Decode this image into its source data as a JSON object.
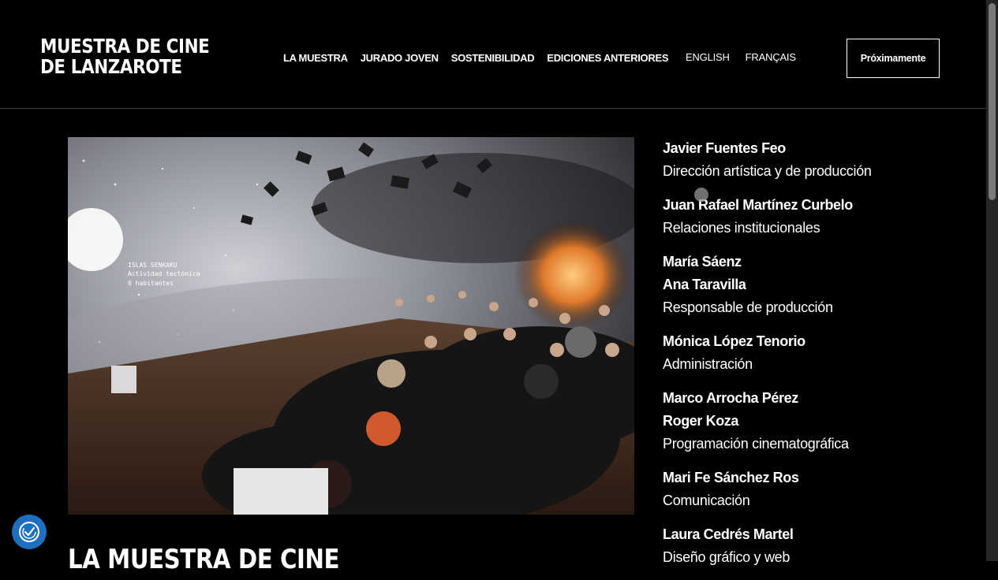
{
  "header": {
    "logo_line1": "MUESTRA DE CINE",
    "logo_line2": "DE LANZAROTE",
    "nav": [
      "LA MUESTRA",
      "JURADO JOVEN",
      "SOSTENIBILIDAD",
      "EDICIONES ANTERIORES"
    ],
    "languages": [
      "ENGLISH",
      "FRANÇAIS"
    ],
    "cta_label": "Próximamente"
  },
  "photo": {
    "screen_text_line1": "ISLAS SENKAKU",
    "screen_text_line2": "Actividad tectónica",
    "screen_text_line3": "0 habitantes"
  },
  "credits": [
    {
      "names": [
        "Javier Fuentes Feo"
      ],
      "role": "Dirección artística y de producción"
    },
    {
      "names": [
        "Juan Rafael Martínez Curbelo"
      ],
      "role": "Relaciones institucionales"
    },
    {
      "names": [
        "María Sáenz",
        "Ana Taravilla"
      ],
      "role": "Responsable de producción"
    },
    {
      "names": [
        "Mónica López Tenorio"
      ],
      "role": "Administración"
    },
    {
      "names": [
        "Marco Arrocha Pérez",
        "Roger Koza"
      ],
      "role": "Programación cinematográfica"
    },
    {
      "names": [
        "Mari Fe Sánchez Ros"
      ],
      "role": "Comunicación"
    },
    {
      "names": [
        "Laura Cedrés Martel"
      ],
      "role": "Diseño gráfico y web"
    }
  ],
  "section_title": "LA MUESTRA DE CINE",
  "colors": {
    "background": "#000000",
    "text": "#ffffff",
    "accessibility_button": "#1f6fbf"
  },
  "icons": {
    "accessibility": "accessibility-icon"
  }
}
